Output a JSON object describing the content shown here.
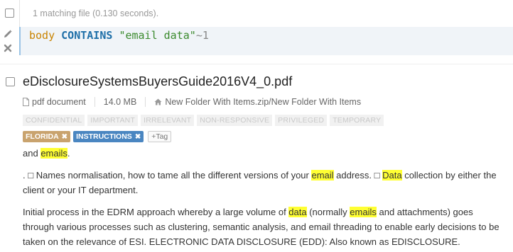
{
  "status": {
    "text": "1 matching file (0.130 seconds)."
  },
  "query": {
    "field": "body",
    "operator": "CONTAINS",
    "value": "\"email data\"",
    "fuzzy": "~1"
  },
  "result": {
    "title": "eDisclosureSystemsBuyersGuide2016V4_0.pdf",
    "doc_type": "pdf document",
    "size": "14.0 MB",
    "path": "New Folder With Items.zip/New Folder With Items",
    "grey_tags": [
      "CONFIDENTIAL",
      "IMPORTANT",
      "IRRELEVANT",
      "NON-RESPONSIVE",
      "PRIVILEGED",
      "TEMPORARY"
    ],
    "active_tags": [
      "FLORIDA",
      "INSTRUCTIONS"
    ],
    "tag_x": "✖",
    "add_tag_label": "Tag",
    "add_tag_plus": "+",
    "snippets": {
      "s1": {
        "a": "and ",
        "b": "emails",
        "c": "."
      },
      "s2": {
        "a": ". □ Names normalisation, how to tame all the different versions of your ",
        "b": "email",
        "c": " address. □ ",
        "d": "Data",
        "e": " collection by either the client or your IT department."
      },
      "s3": {
        "a": "Initial process in the EDRM approach whereby a large volume of ",
        "b": "data",
        "c": " (normally ",
        "d": "emails",
        "e": " and attachments) goes through various processes such as clustering, semantic analysis, and email threading to enable early decisions to be taken on the relevance of ESI. ELECTRONIC DATA DISCLOSURE (EDD): Also known as EDISCLOSURE."
      }
    }
  },
  "colors": {
    "highlight": "#ffff33",
    "florida": "#c9a36e",
    "instructions": "#4a86c1",
    "query_border": "#9bc4e6"
  },
  "icons": [
    "pencil-icon",
    "close-icon",
    "pdf-icon",
    "home-icon"
  ]
}
